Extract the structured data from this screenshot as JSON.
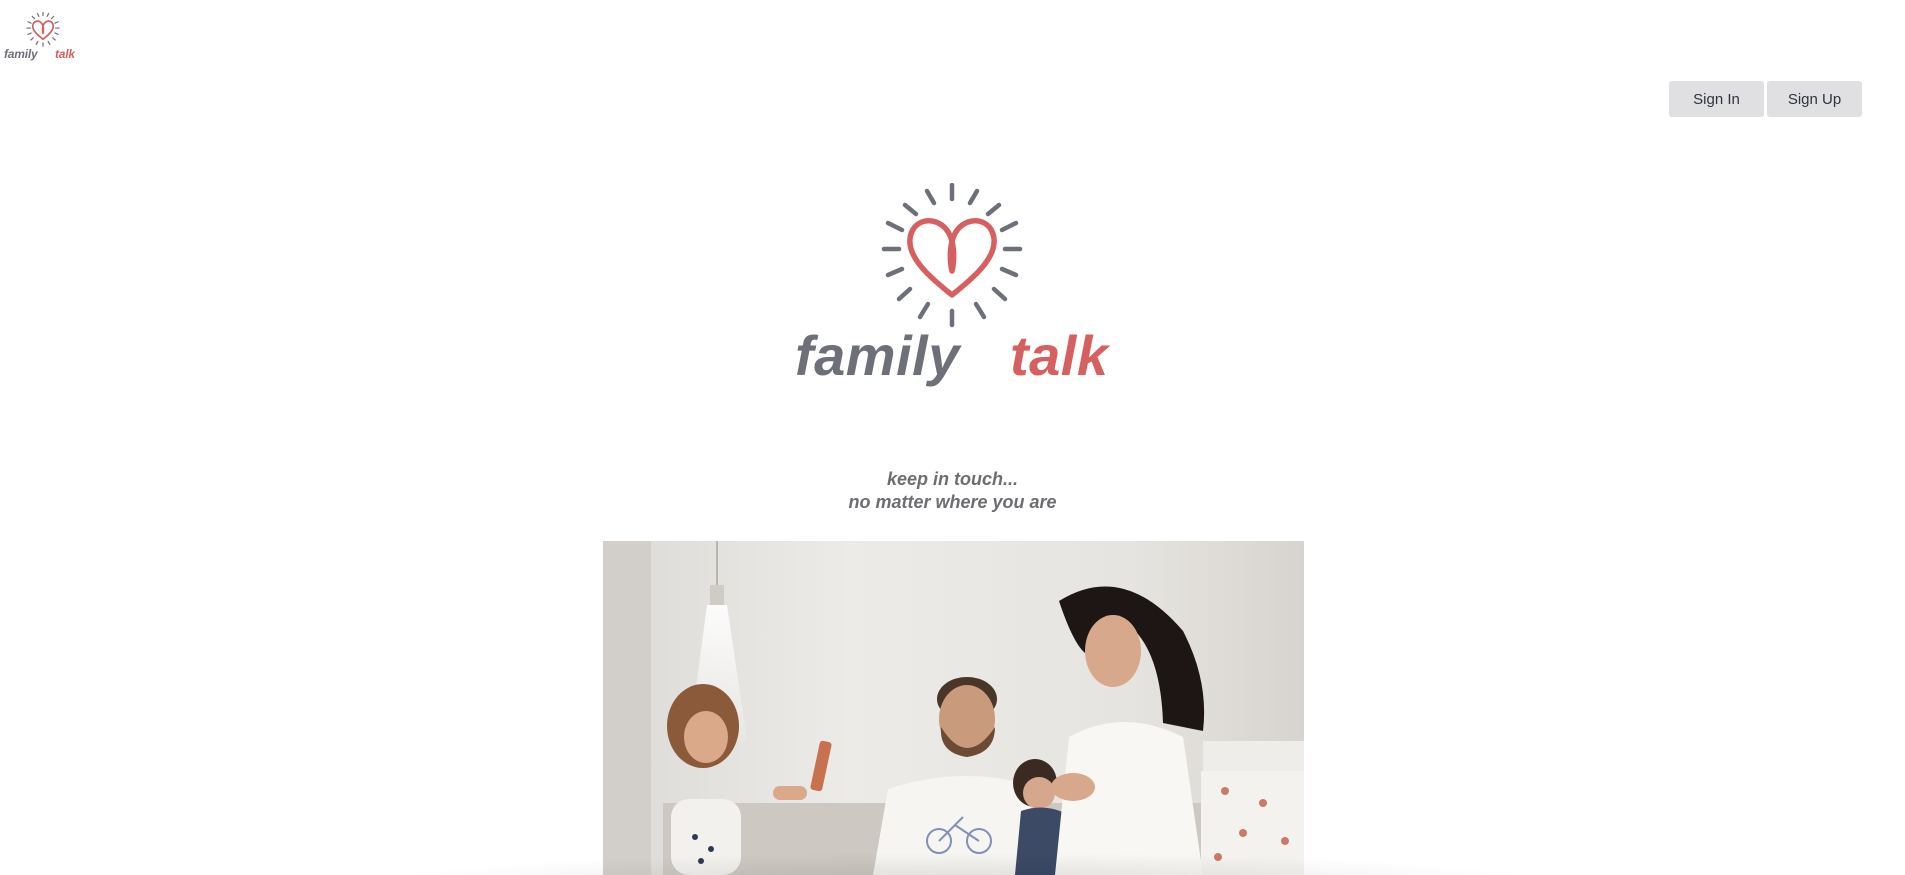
{
  "brand": {
    "word_family": "family",
    "word_talk": "talk",
    "colors": {
      "gray": "#6e7079",
      "red": "#d6605f"
    },
    "logo_icon": "heart-sunburst-icon"
  },
  "header": {
    "sign_in_label": "Sign In",
    "sign_up_label": "Sign Up"
  },
  "hero": {
    "tagline_line1": "keep in touch...",
    "tagline_line2": "no matter where you are",
    "photo_icon": "family-photo"
  }
}
